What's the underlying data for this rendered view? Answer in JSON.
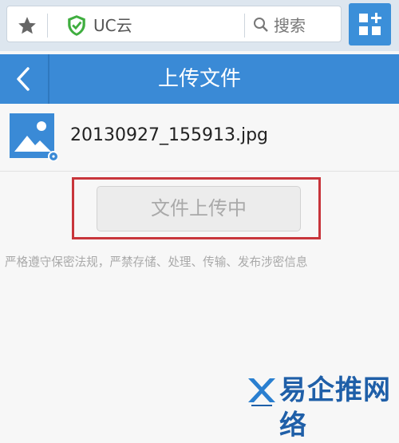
{
  "browser": {
    "url_text": "UC云",
    "search_label": "搜索",
    "icons": {
      "bookmark": "star-icon",
      "secure": "shield-check-icon",
      "search": "search-icon",
      "menu": "grid-plus-icon"
    }
  },
  "header": {
    "title": "上传文件",
    "back_icon": "chevron-left-icon"
  },
  "file": {
    "name": "20130927_155913.jpg",
    "thumb_icon": "image-icon"
  },
  "upload_button_label": "文件上传中",
  "notice_text": "严格遵守保密法规，严禁存储、处理、传输、发布涉密信息",
  "watermark": {
    "text": "易企推网络",
    "logo_icon": "x-logo-icon"
  },
  "colors": {
    "accent": "#3a8ad6",
    "highlight_frame": "#c8353b",
    "secure_green": "#3fae3f",
    "watermark": "#1f5fa8"
  }
}
